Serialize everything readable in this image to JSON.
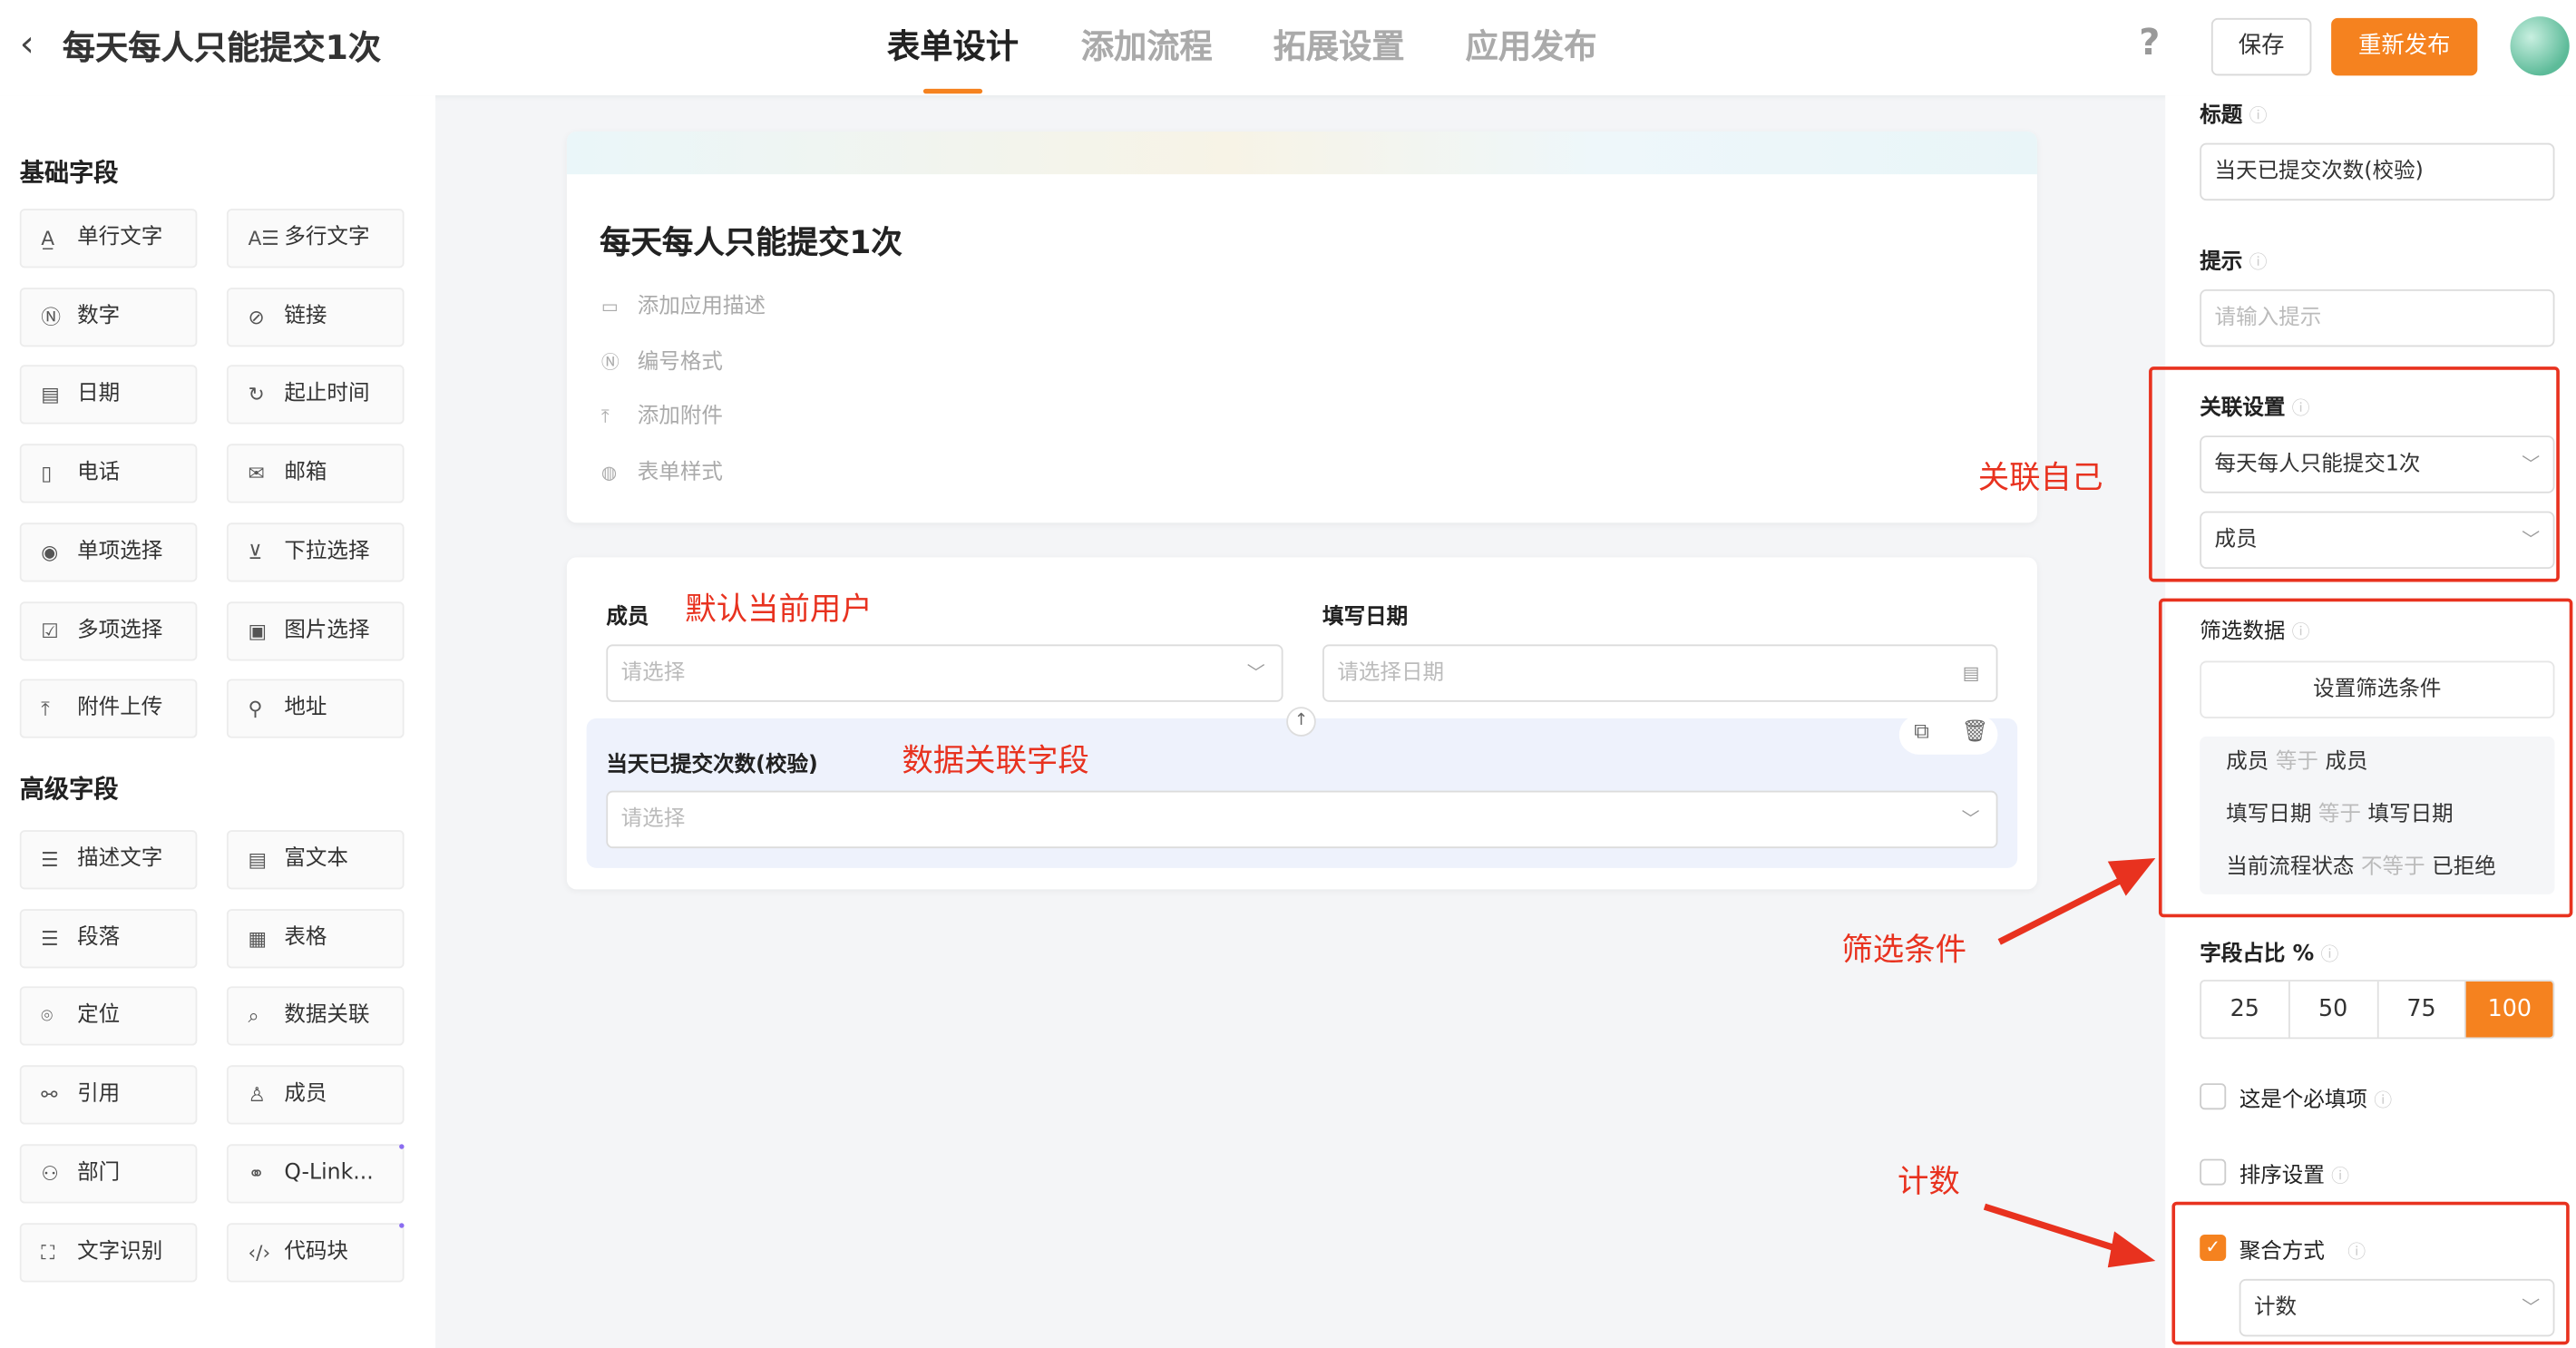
{
  "header": {
    "back_icon": "chevron-left-icon",
    "title": "每天每人只能提交1次",
    "tabs": [
      "表单设计",
      "添加流程",
      "拓展设置",
      "应用发布"
    ],
    "help_icon": "?",
    "save_label": "保存",
    "publish_label": "重新发布",
    "accent": "#f5821f"
  },
  "left": {
    "basic_title": "基础字段",
    "basic": [
      {
        "label": "单行文字",
        "icon": "A̲"
      },
      {
        "label": "多行文字",
        "icon": "A☰"
      },
      {
        "label": "数字",
        "icon": "Ⓝ"
      },
      {
        "label": "链接",
        "icon": "⊘"
      },
      {
        "label": "日期",
        "icon": "▤"
      },
      {
        "label": "起止时间",
        "icon": "↻"
      },
      {
        "label": "电话",
        "icon": "▯"
      },
      {
        "label": "邮箱",
        "icon": "✉"
      },
      {
        "label": "单项选择",
        "icon": "◉"
      },
      {
        "label": "下拉选择",
        "icon": "⊻"
      },
      {
        "label": "多项选择",
        "icon": "☑"
      },
      {
        "label": "图片选择",
        "icon": "▣"
      },
      {
        "label": "附件上传",
        "icon": "⤒"
      },
      {
        "label": "地址",
        "icon": "⚲"
      }
    ],
    "advanced_title": "高级字段",
    "advanced": [
      {
        "label": "描述文字",
        "icon": "☰"
      },
      {
        "label": "富文本",
        "icon": "▤"
      },
      {
        "label": "段落",
        "icon": "☰"
      },
      {
        "label": "表格",
        "icon": "▦"
      },
      {
        "label": "定位",
        "icon": "⌾"
      },
      {
        "label": "数据关联",
        "icon": "⌕"
      },
      {
        "label": "引用",
        "icon": "⚯"
      },
      {
        "label": "成员",
        "icon": "♙"
      },
      {
        "label": "部门",
        "icon": "⚇"
      },
      {
        "label": "Q-Link...",
        "icon": "⚭"
      },
      {
        "label": "文字识别",
        "icon": "⛶"
      },
      {
        "label": "代码块",
        "icon": "‹/›"
      }
    ]
  },
  "form": {
    "title": "每天每人只能提交1次",
    "meta": [
      {
        "label": "添加应用描述",
        "icon": "▭"
      },
      {
        "label": "编号格式",
        "icon": "Ⓝ"
      },
      {
        "label": "添加附件",
        "icon": "⤒"
      },
      {
        "label": "表单样式",
        "icon": "◍"
      }
    ],
    "member_label": "成员",
    "member_placeholder": "请选择",
    "date_label": "填写日期",
    "date_placeholder": "请选择日期",
    "count_label": "当天已提交次数(校验)",
    "count_placeholder": "请选择"
  },
  "annotations": {
    "default_user": "默认当前用户",
    "data_link_field": "数据关联字段",
    "link_self": "关联自己",
    "filter_cond": "筛选条件",
    "count": "计数"
  },
  "panel": {
    "title_label": "标题",
    "title_value": "当天已提交次数(校验)",
    "hint_label": "提示",
    "hint_placeholder": "请输入提示",
    "assoc_label": "关联设置",
    "assoc_form": "每天每人只能提交1次",
    "assoc_field": "成员",
    "filter_label": "筛选数据",
    "filter_button": "设置筛选条件",
    "conditions": [
      {
        "field": "成员",
        "op": "等于",
        "value": "成员"
      },
      {
        "field": "填写日期",
        "op": "等于",
        "value": "填写日期"
      },
      {
        "field": "当前流程状态",
        "op": "不等于",
        "value": "已拒绝"
      }
    ],
    "width_label": "字段占比 %",
    "widths": [
      "25",
      "50",
      "75",
      "100"
    ],
    "selected_width": "100",
    "required_label": "这是个必填项",
    "sort_label": "排序设置",
    "agg_label": "聚合方式",
    "agg_value": "计数"
  }
}
